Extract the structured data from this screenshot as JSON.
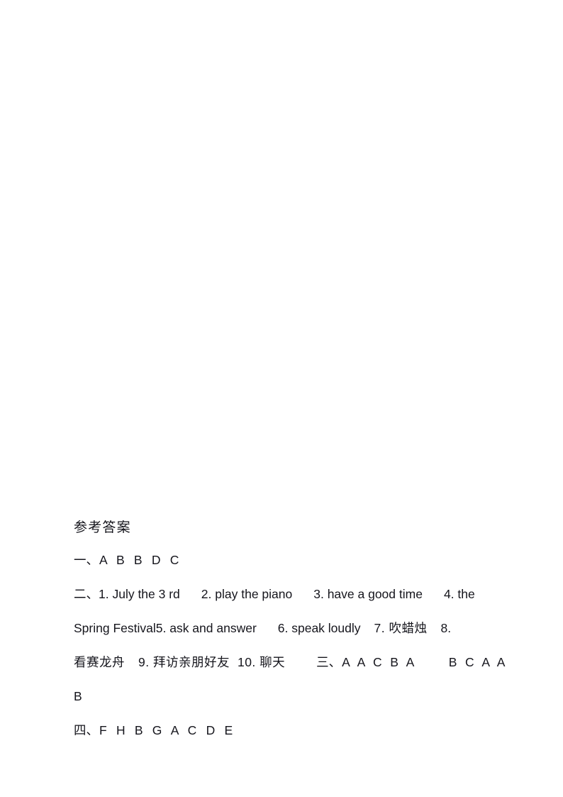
{
  "document": {
    "page_background": "#ffffff",
    "text_color": "#15151c",
    "heading": "参考答案",
    "sections": [
      {
        "id": "section-1",
        "marker": "一、",
        "answers": "A B B D C"
      },
      {
        "id": "section-2",
        "marker": "二、",
        "items": [
          "1. July the 3 rd",
          "2. play the piano",
          "3. have a good time",
          "4. the Spring Festival",
          "5. ask and answer",
          "6. speak loudly",
          "7. 吹蜡烛",
          "8. 看赛龙舟",
          "9. 拜访亲朋好友",
          "10. 聊天"
        ],
        "line_1": "二、1. July the 3 rd    2. play the piano    3. have a good time    4. the",
        "line_2": "Spring Festival5. ask and answer    6. speak loudly    7. 吹蜡烛    8.",
        "line_3_prefix": "看赛龙舟    9. 拜访亲朋好友 10. 聊天"
      },
      {
        "id": "section-3",
        "marker": "三、",
        "answers_group_1": "A A C B A",
        "answers_group_2": "B C A A",
        "answers_group_3": "B"
      },
      {
        "id": "section-4",
        "marker": "四、",
        "answers": "F H B G A C D E"
      }
    ],
    "line_fragments": {
      "l2_marker": "二、",
      "l2_item1": "1. July the 3 rd",
      "l2_item2": "2. play the piano",
      "l2_item3": "3. have a good time",
      "l2_item4": "4. the",
      "l3_item4_cont": "Spring Festival",
      "l3_item5": "5. ask and answer",
      "l3_item6": "6. speak loudly",
      "l3_item7": "7. 吹蜡烛",
      "l3_item8": "8.",
      "l4_item8_cont": "看赛龙舟",
      "l4_item9": "9. 拜访亲朋好友",
      "l4_item10": "10. 聊天",
      "l4_sec3_marker": "三、",
      "l4_sec3_a": "A A C B A",
      "l4_sec3_b": "B C A A",
      "l5_sec3_c": "B",
      "l6_sec4_marker": "四、",
      "l6_sec4_answers": "F H B G A C D E",
      "l1_sec1_marker": "一、",
      "l1_sec1_answers": "A B B D C"
    }
  }
}
